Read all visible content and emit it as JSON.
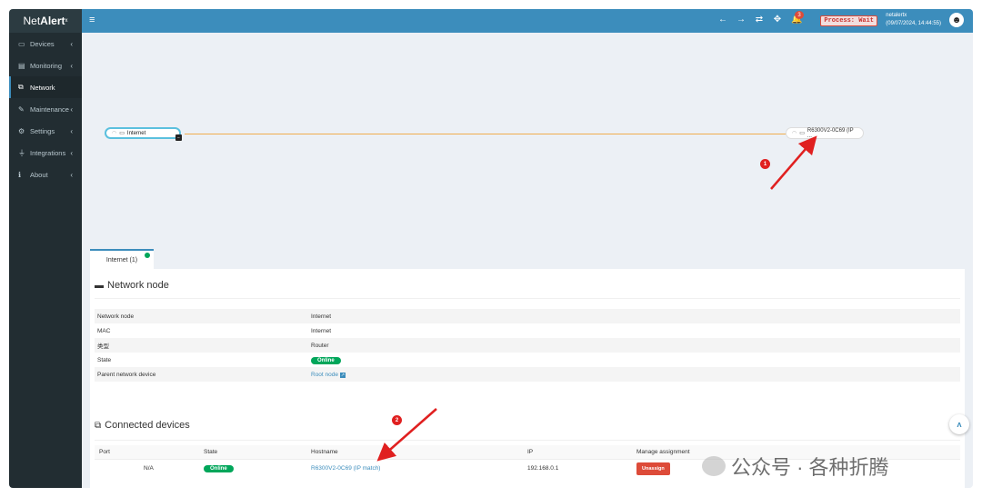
{
  "app": {
    "logo_net": "Net",
    "logo_alert": "Alert",
    "logo_x": "x"
  },
  "topbar": {
    "notification_count": "3",
    "process_status": "Process: Wait",
    "user_name": "netalertx",
    "user_time": "(09/07/2024, 14:44:55)"
  },
  "sidebar": {
    "items": [
      {
        "label": "Devices"
      },
      {
        "label": "Monitoring"
      },
      {
        "label": "Network"
      },
      {
        "label": "Maintenance"
      },
      {
        "label": "Settings"
      },
      {
        "label": "Integrations"
      },
      {
        "label": "About"
      }
    ]
  },
  "network_map": {
    "root_node": "Internet",
    "child_node": "R6300V2-0C69 (IP ..."
  },
  "tab": {
    "label": "Internet (1)"
  },
  "network_node": {
    "title": "Network node",
    "rows": [
      {
        "key": "Network node",
        "value": "Internet"
      },
      {
        "key": "MAC",
        "value": "Internet"
      },
      {
        "key": "类型",
        "value": "Router"
      },
      {
        "key": "State",
        "value": "Online"
      },
      {
        "key": "Parent network device",
        "value": "Root node"
      }
    ]
  },
  "connected": {
    "title": "Connected devices",
    "headers": [
      "Port",
      "State",
      "Hostname",
      "IP",
      "Manage assignment"
    ],
    "row": {
      "port": "N/A",
      "state": "Online",
      "hostname": "R6300V2-0C69 (IP match)",
      "ip": "192.168.0.1",
      "action": "Unassign"
    }
  },
  "annotations": {
    "marker1": "1",
    "marker2": "2"
  },
  "watermark": {
    "text": "公众号 · 各种折腾"
  },
  "colors": {
    "primary": "#3c8dbc",
    "sidebar": "#222d32",
    "online": "#00a65a",
    "danger": "#dd4b39",
    "arrow": "#e02020"
  }
}
